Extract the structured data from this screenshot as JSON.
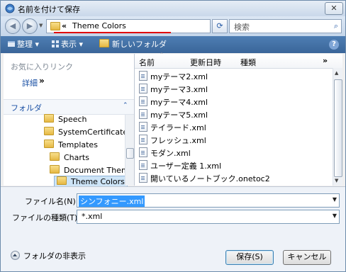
{
  "window": {
    "title": "名前を付けて保存",
    "close_glyph": "✕"
  },
  "nav": {
    "back_glyph": "◀",
    "forward_glyph": "▶",
    "dropdown_glyph": "▼"
  },
  "address": {
    "separator": "«",
    "path": "Theme Colors",
    "dropdown_glyph": "▼",
    "refresh_glyph": "⟳"
  },
  "search": {
    "placeholder": "検索",
    "icon_glyph": "⌕"
  },
  "toolbar": {
    "organize": "整理 ▾",
    "views": "表示 ▾",
    "new_folder": "新しいフォルダ",
    "help_glyph": "?"
  },
  "favorites": {
    "heading": "お気に入りリンク",
    "details_link": "詳細",
    "details_arrow": "»"
  },
  "folders_pane": {
    "heading": "フォルダ",
    "chevron": "⌃",
    "items": [
      {
        "label": "Speech"
      },
      {
        "label": "SystemCertificates"
      },
      {
        "label": "Templates"
      },
      {
        "label": "Charts"
      },
      {
        "label": "Document Theme"
      },
      {
        "label": "Theme Colors"
      }
    ]
  },
  "file_list": {
    "columns": [
      "名前",
      "更新日時",
      "種類"
    ],
    "sort_glyph": "⌃",
    "more_columns": "»",
    "scroll_up": "▲",
    "scroll_down": "▼",
    "files": [
      {
        "name": "myテーマ2.xml"
      },
      {
        "name": "myテーマ3.xml"
      },
      {
        "name": "myテーマ4.xml"
      },
      {
        "name": "myテーマ5.xml"
      },
      {
        "name": "テイラード.xml"
      },
      {
        "name": "フレッシュ.xml"
      },
      {
        "name": "モダン.xml"
      },
      {
        "name": "ユーザー定義 1.xml"
      },
      {
        "name": "開いているノートブック.onetoc2"
      }
    ]
  },
  "form": {
    "filename_label": "ファイル名(N):",
    "filename_value": "シンフォニー.xml",
    "filetype_label": "ファイルの種類(T):",
    "filetype_value": "*.xml",
    "dropdown_glyph": "▼"
  },
  "footer": {
    "hide_folders": "フォルダの非表示",
    "save_button": "保存(S)",
    "cancel_button": "キャンセル"
  },
  "colors": {
    "toolbar": "#3f6b9f",
    "selection": "#3399ff",
    "address_underline": "#e00000",
    "link": "#1a50a4"
  }
}
